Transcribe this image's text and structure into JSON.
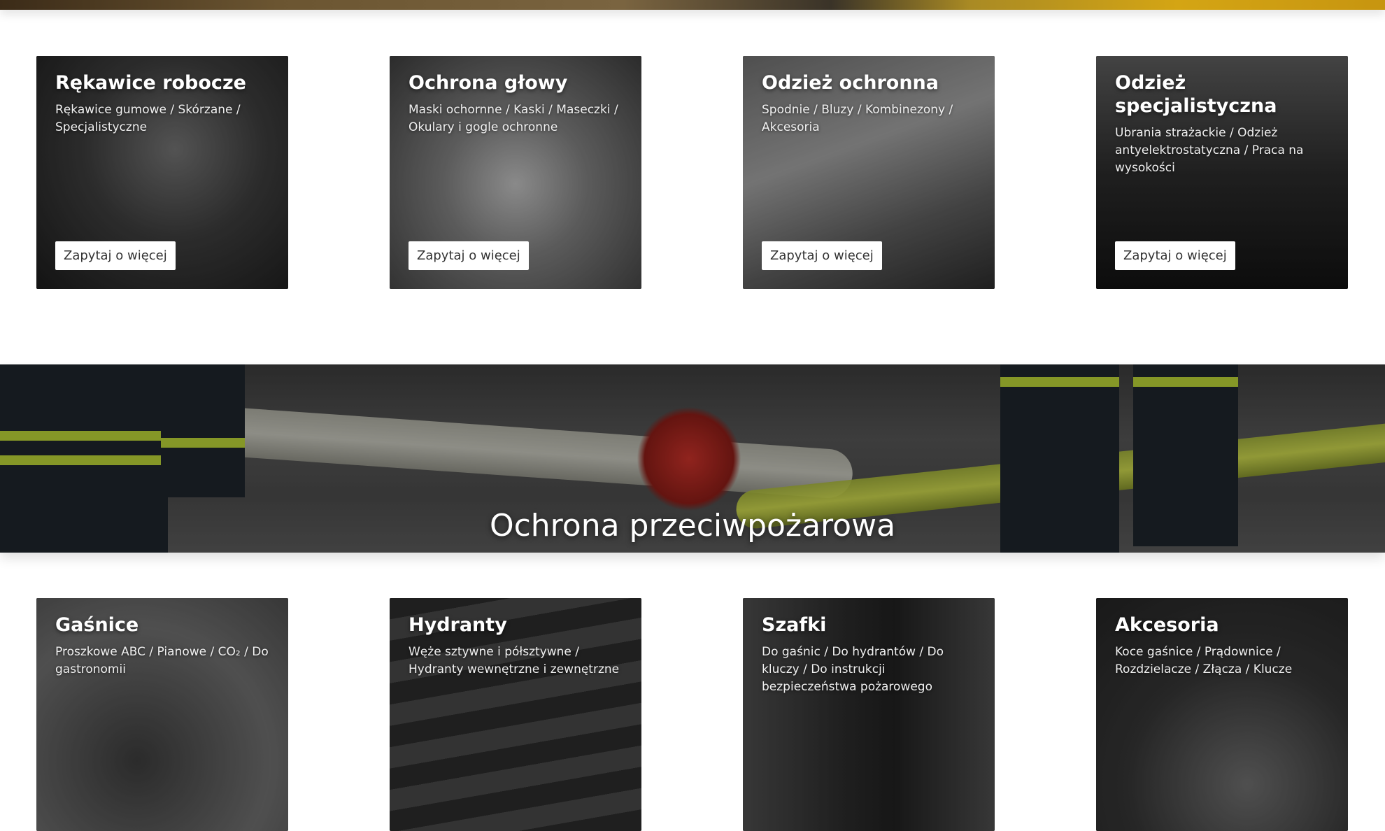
{
  "section1": {
    "cards": [
      {
        "title": "Rękawice robocze",
        "description": "Rękawice gumowe / Skórzane / Specjalistyczne",
        "button_label": "Zapytaj o więcej"
      },
      {
        "title": "Ochrona głowy",
        "description": "Maski ochornne / Kaski / Maseczki / Okulary i gogle ochronne",
        "button_label": "Zapytaj o więcej"
      },
      {
        "title": "Odzież ochronna",
        "description": "Spodnie / Bluzy / Kombinezony / Akcesoria",
        "button_label": "Zapytaj o więcej"
      },
      {
        "title": "Odzież specjalistyczna",
        "description": "Ubrania strażackie / Odzież antyelektrostatyczna / Praca na wysokości",
        "button_label": "Zapytaj o więcej"
      }
    ]
  },
  "banner": {
    "title": "Ochrona przeciwpożarowa"
  },
  "section2": {
    "cards": [
      {
        "title": "Gaśnice",
        "description": "Proszkowe ABC / Pianowe / CO₂ / Do gastronomii"
      },
      {
        "title": "Hydranty",
        "description": "Węże sztywne i półsztywne / Hydranty wewnętrzne i zewnętrzne"
      },
      {
        "title": "Szafki",
        "description": "Do gaśnic / Do hydrantów / Do kluczy / Do instrukcji bezpieczeństwa pożarowego"
      },
      {
        "title": "Akcesoria",
        "description": "Koce gaśnice / Prądownice / Rozdzielacze / Złącza / Klucze"
      }
    ]
  },
  "colors": {
    "accent": "#b9d236",
    "button_bg": "#ffffff",
    "button_text": "#333333"
  }
}
